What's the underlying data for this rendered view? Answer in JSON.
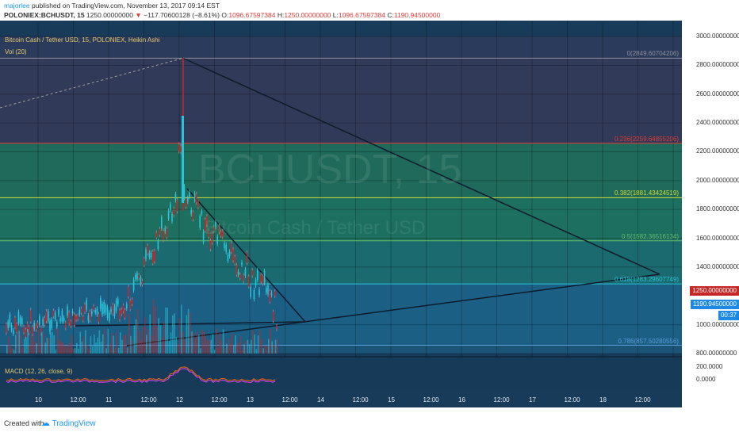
{
  "header": {
    "user": "majorlee",
    "published": "published on TradingView.com, November 13, 2017 09:14 EST",
    "symbol": "POLONIEX:BCHUSDT, 15",
    "price_last": "1250.00000000",
    "change_arrow": "▼",
    "change": "−117.70600128 (−8.61%)",
    "o_label": "O:",
    "o_val": "1096.67597384",
    "h_label": "H:",
    "h_val": "1250.00000000",
    "l_label": "L:",
    "l_val": "1096.67597384",
    "c_label": "C:",
    "c_val": "1190.94500000"
  },
  "chart": {
    "legend_main": "Bitcoin Cash / Tether USD, 15, POLONIEX, Heikin Ashi",
    "legend_vol": "Vol (20)",
    "watermark_big": "BCHUSDT, 15",
    "watermark_small": "Bitcoin Cash / Tether USD",
    "macd_label": "MACD (12, 26, close, 9)",
    "colors": {
      "background": "#183b5a",
      "up": "#26c6da",
      "down": "#c62828",
      "trendline": "#0d1b2a"
    }
  },
  "fib_levels": [
    {
      "label": "0(2849.60704206)",
      "price": 2849.607
    },
    {
      "label": "0.236(2259.64855206)",
      "price": 2259.649
    },
    {
      "label": "0.382(1881.43424519)",
      "price": 1881.434
    },
    {
      "label": "0.5(1582.36516134)",
      "price": 1582.365
    },
    {
      "label": "0.618(1283.29607749)",
      "price": 1283.296
    },
    {
      "label": "0.786(857.50280556)",
      "price": 857.503
    }
  ],
  "price_axis": [
    "3000.00000000",
    "2800.00000000",
    "2600.00000000",
    "2400.00000000",
    "2200.00000000",
    "2000.00000000",
    "1800.00000000",
    "1600.00000000",
    "1400.00000000",
    "1000.00000000",
    "800.00000000"
  ],
  "price_tags": {
    "high": "1250.00000000",
    "close": "1190.94500000",
    "timer": "00:37"
  },
  "macd_axis": [
    "200.0000",
    "0.0000"
  ],
  "time_axis": [
    "10",
    "12:00",
    "11",
    "12:00",
    "12",
    "12:00",
    "13",
    "12:00",
    "14",
    "12:00",
    "15",
    "12:00",
    "16",
    "12:00",
    "17",
    "12:00",
    "18",
    "12:00"
  ],
  "footer": {
    "created": "Created with",
    "brand": "TradingView"
  }
}
